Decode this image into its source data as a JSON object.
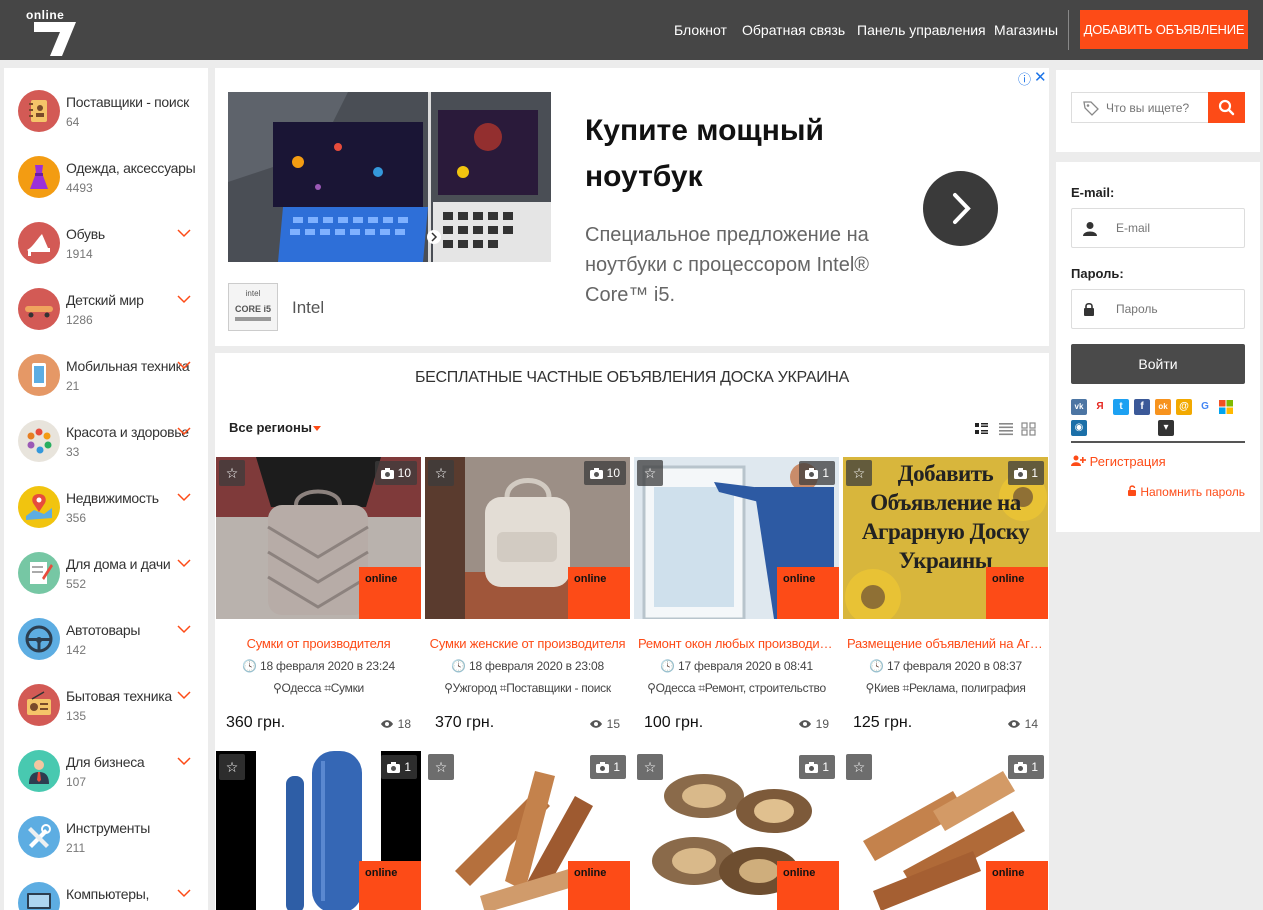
{
  "header": {
    "logo_text": "online",
    "nav": [
      "Блокнот",
      "Обратная связь",
      "Панель управления",
      "Магазины"
    ],
    "add_button": "ДОБАВИТЬ ОБЪЯВЛЕНИЕ"
  },
  "sidebar": {
    "categories": [
      {
        "name": "Поставщики - поиск",
        "count": "64",
        "icon": "address-book-icon",
        "color": "#d35a55",
        "has_submenu": false
      },
      {
        "name": "Одежда, аксессуары",
        "count": "4493",
        "icon": "dress-icon",
        "color": "#f39c12",
        "has_submenu": false
      },
      {
        "name": "Обувь",
        "count": "1914",
        "icon": "high-heel-icon",
        "color": "#d35a55",
        "has_submenu": true
      },
      {
        "name": "Детский мир",
        "count": "1286",
        "icon": "skateboard-icon",
        "color": "#d35a55",
        "has_submenu": true
      },
      {
        "name": "Мобильная техника",
        "count": "21",
        "icon": "mobile-phone-icon",
        "color": "#e59866",
        "has_submenu": true
      },
      {
        "name": "Красота и здоровье",
        "count": "33",
        "icon": "palette-icon",
        "color": "#e0e0e0",
        "has_submenu": true
      },
      {
        "name": "Недвижимость",
        "count": "356",
        "icon": "map-pin-icon",
        "color": "#f1c40f",
        "has_submenu": true
      },
      {
        "name": "Для дома и дачи",
        "count": "552",
        "icon": "notepad-icon",
        "color": "#76c7a4",
        "has_submenu": true
      },
      {
        "name": "Автотовары",
        "count": "142",
        "icon": "steering-wheel-icon",
        "color": "#5dade2",
        "has_submenu": true
      },
      {
        "name": "Бытовая техника",
        "count": "135",
        "icon": "radio-icon",
        "color": "#d35a55",
        "has_submenu": true
      },
      {
        "name": "Для бизнеса",
        "count": "107",
        "icon": "businessman-icon",
        "color": "#48c9b0",
        "has_submenu": true
      },
      {
        "name": "Инструменты",
        "count": "211",
        "icon": "tools-icon",
        "color": "#5dade2",
        "has_submenu": false
      },
      {
        "name": "Компьютеры,",
        "count": "",
        "icon": "computer-icon",
        "color": "#5dade2",
        "has_submenu": true
      }
    ]
  },
  "ad": {
    "title": "Купите мощный ноутбук",
    "text": "Специальное предложение на ноутбуки с процессором Intel® Core™ i5.",
    "brand": "Intel",
    "brand_badge": "CORE i5",
    "info_glyph": "ⓘ",
    "close_glyph": "✕"
  },
  "listing": {
    "title": "БЕСПЛАТНЫЕ ЧАСТНЫЕ ОБЪЯВЛЕНИЯ ДОСКА УКРАИНА",
    "region": "Все регионы",
    "cards": [
      {
        "title": "Сумки от производителя",
        "date": "18 февраля 2020 в 23:24",
        "city": "Одесса",
        "category": "Сумки",
        "price": "360 грн.",
        "views": "18",
        "photos": "10",
        "image": "backpack-grey"
      },
      {
        "title": "Сумки женские от производителя",
        "date": "18 февраля 2020 в 23:08",
        "city": "Ужгород",
        "category": "Поставщики - поиск",
        "price": "370 грн.",
        "views": "15",
        "photos": "10",
        "image": "backpack-white"
      },
      {
        "title": "Ремонт окон любых производителей",
        "date": "17 февраля 2020 в 08:41",
        "city": "Одесса",
        "category": "Ремонт, строительство",
        "price": "100 грн.",
        "views": "19",
        "photos": "1",
        "image": "window-repair"
      },
      {
        "title": "Размещение объявлений на Аграрную доску",
        "date": "17 февраля 2020 в 08:37",
        "city": "Киев",
        "category": "Реклама, полиграфия",
        "price": "125 грн.",
        "views": "14",
        "photos": "1",
        "image": "sunflowers",
        "image_text": "Добавить Объявление на Аграрную Доску Украины"
      },
      {
        "title": "",
        "photos": "1",
        "image": "iqos-device"
      },
      {
        "title": "",
        "photos": "1",
        "image": "firewood-1"
      },
      {
        "title": "",
        "photos": "1",
        "image": "firewood-2"
      },
      {
        "title": "",
        "photos": "1",
        "image": "firewood-3"
      }
    ],
    "badge_text": "online"
  },
  "right": {
    "search_placeholder": "Что вы ищете?",
    "email_label": "E-mail:",
    "email_placeholder": "E-mail",
    "password_label": "Пароль:",
    "password_placeholder": "Пароль",
    "login_button": "Войти",
    "register": "Регистрация",
    "remind": "Напомнить пароль",
    "socials": [
      {
        "name": "vk-icon",
        "color": "#4c75a3",
        "glyph": "vk"
      },
      {
        "name": "yandex-icon",
        "color": "#ffffff",
        "glyph": "Я"
      },
      {
        "name": "twitter-icon",
        "color": "#1da1f2",
        "glyph": "t"
      },
      {
        "name": "facebook-icon",
        "color": "#3b5998",
        "glyph": "f"
      },
      {
        "name": "odnoklassniki-icon",
        "color": "#f7931e",
        "glyph": "ok"
      },
      {
        "name": "mailru-icon",
        "color": "#f2a900",
        "glyph": "@"
      },
      {
        "name": "google-icon",
        "color": "#ffffff",
        "glyph": "G"
      },
      {
        "name": "microsoft-icon",
        "color": "#ffffff",
        "glyph": "▦"
      },
      {
        "name": "steam-icon",
        "color": "#1b6fa8",
        "glyph": "◉"
      },
      {
        "name": "dropdown-icon",
        "color": "#333333",
        "glyph": "▾"
      }
    ]
  }
}
